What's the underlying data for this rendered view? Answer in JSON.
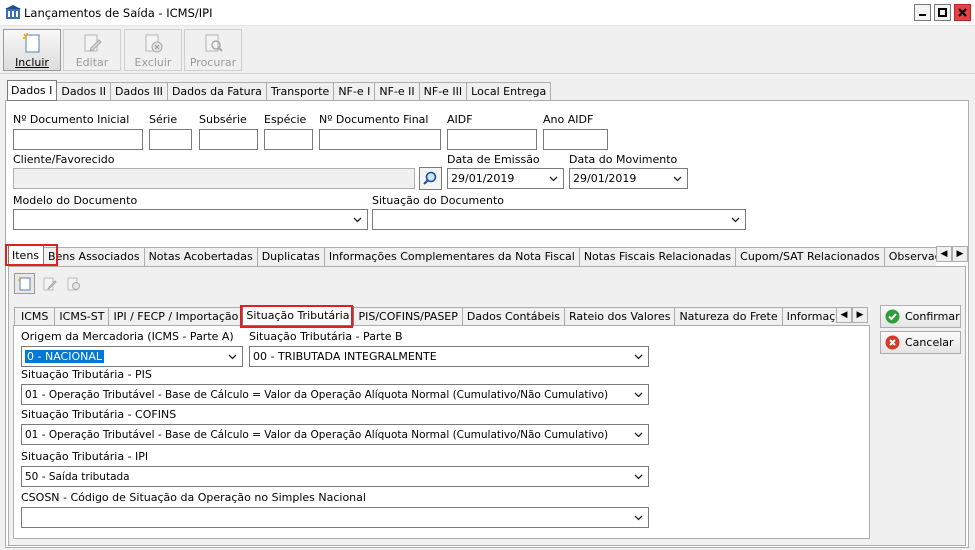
{
  "window": {
    "title": "Lançamentos de Saída - ICMS/IPI"
  },
  "toolbar": {
    "incluir": "Incluir",
    "editar": "Editar",
    "excluir": "Excluir",
    "procurar": "Procurar"
  },
  "main_tabs": [
    "Dados I",
    "Dados II",
    "Dados III",
    "Dados da Fatura",
    "Transporte",
    "NF-e I",
    "NF-e II",
    "NF-e III",
    "Local Entrega"
  ],
  "form": {
    "doc_inicial_label": "Nº Documento Inicial",
    "serie_label": "Série",
    "subserie_label": "Subsérie",
    "especie_label": "Espécie",
    "doc_final_label": "Nº Documento Final",
    "aidf_label": "AIDF",
    "ano_aidf_label": "Ano AIDF",
    "cliente_label": "Cliente/Favorecido",
    "data_emissao_label": "Data de Emissão",
    "data_emissao_value": "29/01/2019",
    "data_movimento_label": "Data do Movimento",
    "data_movimento_value": "29/01/2019",
    "modelo_label": "Modelo do Documento",
    "situacao_doc_label": "Situação do Documento"
  },
  "sub_tabs": [
    "Itens",
    "Bens Associados",
    "Notas Acobertadas",
    "Duplicatas",
    "Informações Complementares da Nota Fiscal",
    "Notas Fiscais Relacionadas",
    "Cupom/SAT Relacionados",
    "Observação do"
  ],
  "item_tabs": [
    "ICMS",
    "ICMS-ST",
    "IPI / FECP / Importação",
    "Situação Tributária",
    "PIS/COFINS/PASEP",
    "Dados Contábeis",
    "Rateio dos Valores",
    "Natureza do Frete",
    "Informações"
  ],
  "tributaria": {
    "origem_label": "Origem da Mercadoria (ICMS - Parte A)",
    "origem_value": "0 - NACIONAL",
    "parte_b_label": "Situação Tributária - Parte B",
    "parte_b_value": "00 - TRIBUTADA INTEGRALMENTE",
    "pis_label": "Situação Tributária - PIS",
    "pis_value": "01 - Operação Tributável - Base de Cálculo = Valor da Operação Alíquota Normal (Cumulativo/Não Cumulativo)",
    "cofins_label": "Situação Tributária - COFINS",
    "cofins_value": "01 - Operação Tributável - Base de Cálculo = Valor da Operação Alíquota Normal (Cumulativo/Não Cumulativo)",
    "ipi_label": "Situação Tributária - IPI",
    "ipi_value": "50 - Saída tributada",
    "csosn_label": "CSOSN - Código de Situação da Operação no Simples Nacional",
    "csosn_value": ""
  },
  "actions": {
    "confirmar": "Confirmar",
    "cancelar": "Cancelar"
  },
  "colors": {
    "accent_red": "#e02020",
    "selection": "#0078d7"
  }
}
